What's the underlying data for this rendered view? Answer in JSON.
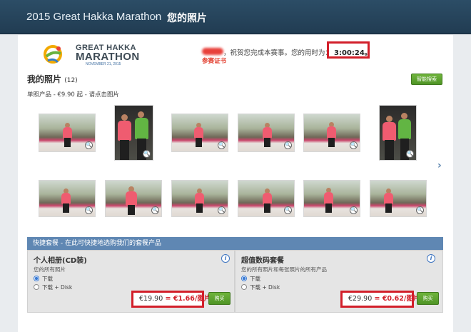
{
  "header": {
    "app_title": "2015 Great Hakka Marathon",
    "separator": "›",
    "page_title": "您的照片"
  },
  "logo": {
    "line1": "GREAT HAKKA",
    "line2": "MARATHON",
    "date": "NOVEMBER 21, 2015",
    "colors": [
      "#f2a900",
      "#6ab23e",
      "#3a7dc1",
      "#e8403a"
    ]
  },
  "congrats": {
    "prefix": "梁",
    "message": "，祝贺您完成本赛事。您的用时为：",
    "time": "3:00:24",
    "suffix": "。",
    "certificate_link": "参赛证书"
  },
  "photos": {
    "title": "我的照片",
    "count": "(12)",
    "search_button": "智能搜索",
    "single_product_info": "单照产品 - €9.90 起 - 请点击图片",
    "next_arrow": "›",
    "zoom_icon": "🔍"
  },
  "packages": {
    "header": "快捷套餐 - 在此可快捷地选购我们的套餐产品",
    "items": [
      {
        "title": "个人相册(CD装)",
        "subtitle": "您的所有照片",
        "options": [
          "下载",
          "下载 + Disk"
        ],
        "selected": 0,
        "price": "€19.90",
        "per_photo": " = €1.66/图片",
        "buy": "购买"
      },
      {
        "title": "超值数码套餐",
        "subtitle": "您的所有照片和每张照片的所有产品",
        "options": [
          "下载",
          "下载 + Disk"
        ],
        "selected": 0,
        "price": "€29.90",
        "per_photo": " = €0.62/图片",
        "buy": "购买"
      }
    ]
  }
}
